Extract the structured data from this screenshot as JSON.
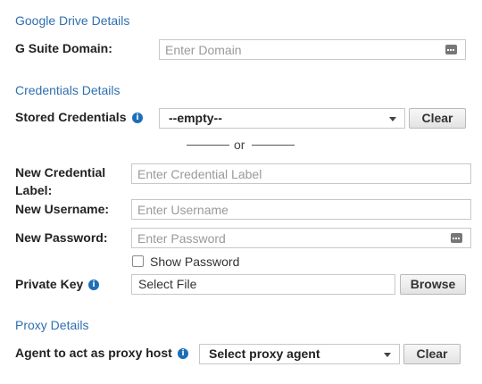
{
  "sections": {
    "drive": "Google Drive Details",
    "credentials": "Credentials Details",
    "proxy": "Proxy Details"
  },
  "gsuite": {
    "label": "G Suite Domain:",
    "placeholder": "Enter Domain"
  },
  "stored": {
    "label": "Stored Credentials",
    "value": "--empty--",
    "clear": "Clear"
  },
  "or_text": "or",
  "new_label": {
    "label_line1": "New Credential",
    "label_line2": "Label:",
    "placeholder": "Enter Credential Label"
  },
  "new_username": {
    "label": "New Username:",
    "placeholder": "Enter Username"
  },
  "new_password": {
    "label": "New Password:",
    "placeholder": "Enter Password"
  },
  "show_password": {
    "label": "Show Password",
    "checked": false
  },
  "private_key": {
    "label": "Private Key",
    "value": "Select File",
    "browse": "Browse"
  },
  "proxy_agent": {
    "label": "Agent to act as proxy host",
    "value": "Select proxy agent",
    "clear": "Clear"
  },
  "colors": {
    "section_title": "#2f6fb0",
    "info_icon": "#1d6fb8"
  }
}
